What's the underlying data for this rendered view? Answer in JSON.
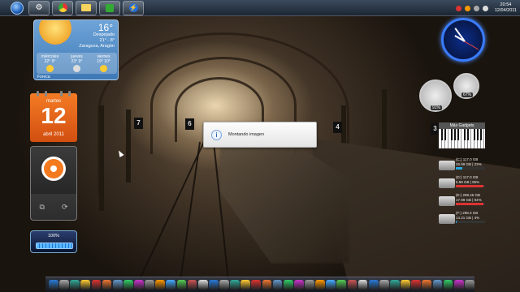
{
  "taskbar": {
    "buttons": [
      "start-orb",
      "control-panel-icon",
      "chrome-icon",
      "folder-icon",
      "media-player-icon",
      "power-icon"
    ],
    "clock_time": "20:54",
    "clock_date": "12/04/2011"
  },
  "weather": {
    "temp": "16°",
    "condition": "Despejado",
    "range": "21° - 8°",
    "city": "Zaragoza, Aragón",
    "days": [
      {
        "name": "miércoles",
        "temps": "22° 9°"
      },
      {
        "name": "jueves",
        "temps": "23° 9°"
      },
      {
        "name": "viernes",
        "temps": "19° 10°"
      }
    ],
    "source": "Foreca"
  },
  "calendar": {
    "weekday": "martes",
    "day": "12",
    "month_year": "abril 2011"
  },
  "progress_gadget": {
    "label": "100%",
    "level": 1.0
  },
  "dialog": {
    "text": "Montando imagen"
  },
  "gauges": {
    "cpu_percent": "91%",
    "ram_percent": "67%"
  },
  "piano": {
    "title": "Más Gadgets"
  },
  "drives": [
    {
      "label": "(C:) 117.0 GB",
      "detail": "26.99 GB | 23%",
      "fill": 0.23,
      "color": "#2ad"
    },
    {
      "label": "(D:) 117.0 GB",
      "detail": "5.99 GB | 95%",
      "fill": 0.95,
      "color": "#d33"
    },
    {
      "label": "(E:) 298.45 GB",
      "detail": "17.99 GB | 94%",
      "fill": 0.94,
      "color": "#d33"
    },
    {
      "label": "(F:) 298.3 GB",
      "detail": "14.21 GB | 4%",
      "fill": 0.04,
      "color": "#2ad"
    }
  ],
  "dock_icon_count": 40,
  "colors": {
    "taskbar": "#1b2632",
    "calendar": "#f47b25",
    "accent": "#3a7cff"
  }
}
